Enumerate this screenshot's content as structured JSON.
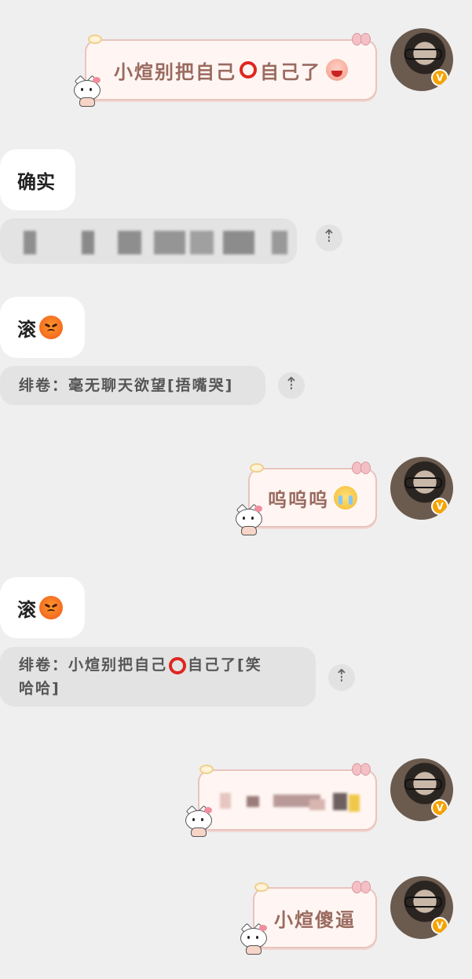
{
  "messages": [
    {
      "side": "right",
      "type": "sticker-text",
      "text_a": "小煊别把自己",
      "text_b": "自己了",
      "emoji": "laugh-emoji"
    },
    {
      "side": "left",
      "type": "text",
      "text": "确实"
    },
    {
      "side": "left",
      "type": "blurred-quote"
    },
    {
      "side": "left",
      "type": "text",
      "text": "滚",
      "emoji": "angry-emoji"
    },
    {
      "side": "left",
      "type": "quote",
      "text": "绯卷：毫无聊天欲望[捂嘴哭]"
    },
    {
      "side": "right",
      "type": "sticker-text",
      "text": "呜呜呜",
      "emoji": "crying-emoji"
    },
    {
      "side": "left",
      "type": "text",
      "text": "滚",
      "emoji": "angry-emoji"
    },
    {
      "side": "left",
      "type": "quote",
      "text_a": "绯卷：小煊别把自己",
      "text_b": "自己了[笑",
      "text_c": "哈哈]"
    },
    {
      "side": "right",
      "type": "sticker-blurred"
    },
    {
      "side": "right",
      "type": "sticker-text",
      "text": "小煊傻逼"
    }
  ],
  "jump_icon": "up-arrow-icon",
  "jump_glyph": "⇡",
  "avatar_badge": "V",
  "colors": {
    "background": "#efefef",
    "sticker_bubble": "#fff6f3",
    "sticker_border": "#e9c3be",
    "sticker_text": "#9a6a5f",
    "quote_bg": "#e3e3e3",
    "badge": "#f5a300"
  }
}
